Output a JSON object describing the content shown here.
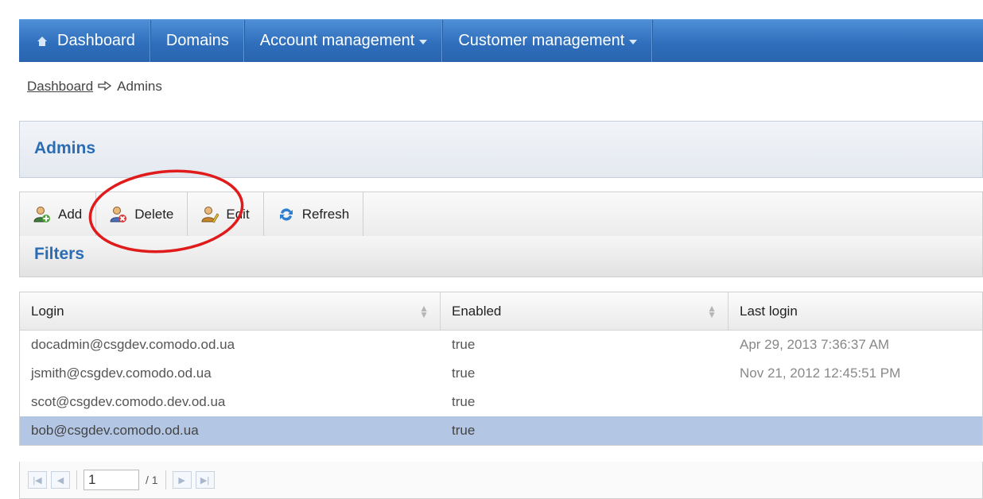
{
  "nav": {
    "items": [
      {
        "label": "Dashboard",
        "icon": "home-icon"
      },
      {
        "label": "Domains"
      },
      {
        "label": "Account management",
        "dropdown": true
      },
      {
        "label": "Customer management",
        "dropdown": true
      }
    ]
  },
  "breadcrumb": {
    "link": "Dashboard",
    "current": "Admins"
  },
  "page": {
    "title": "Admins"
  },
  "toolbar": {
    "add_label": "Add",
    "delete_label": "Delete",
    "edit_label": "Edit",
    "refresh_label": "Refresh"
  },
  "filters": {
    "label": "Filters"
  },
  "table": {
    "columns": [
      "Login",
      "Enabled",
      "Last login"
    ],
    "rows": [
      {
        "login": "docadmin@csgdev.comodo.od.ua",
        "enabled": "true",
        "last_login": "Apr 29, 2013 7:36:37 AM"
      },
      {
        "login": "jsmith@csgdev.comodo.od.ua",
        "enabled": "true",
        "last_login": "Nov 21, 2012 12:45:51 PM"
      },
      {
        "login": "scot@csgdev.comodo.dev.od.ua",
        "enabled": "true",
        "last_login": ""
      },
      {
        "login": "bob@csgdev.comodo.od.ua",
        "enabled": "true",
        "last_login": "",
        "selected": true
      }
    ]
  },
  "pager": {
    "page": "1",
    "total": "/ 1"
  },
  "colors": {
    "nav_bg": "#2f6fbd",
    "title_text": "#2b6cb3",
    "selected_row": "#b3c6e4",
    "annotation": "#e01b1b"
  }
}
